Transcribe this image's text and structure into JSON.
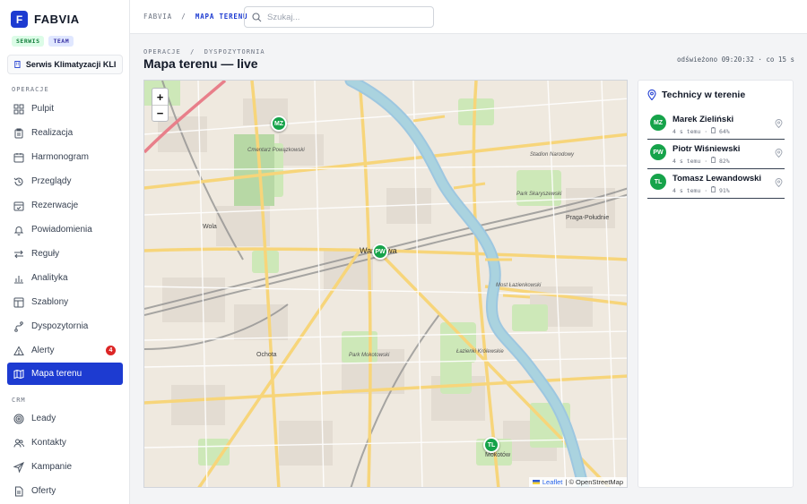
{
  "brand": {
    "name": "FABVIA",
    "logo_letter": "F"
  },
  "badges": [
    "SERWIS",
    "TEAM"
  ],
  "company": {
    "name": "Serwis Klimatyzacji KLIMA"
  },
  "sidebar": {
    "sections": [
      {
        "label": "OPERACJE",
        "items": [
          {
            "label": "Pulpit",
            "icon": "grid-icon"
          },
          {
            "label": "Realizacja",
            "icon": "clipboard-icon"
          },
          {
            "label": "Harmonogram",
            "icon": "calendar-icon"
          },
          {
            "label": "Przeglądy",
            "icon": "history-icon"
          },
          {
            "label": "Rezerwacje",
            "icon": "calendar-check-icon"
          },
          {
            "label": "Powiadomienia",
            "icon": "bell-icon"
          },
          {
            "label": "Reguły",
            "icon": "arrows-icon"
          },
          {
            "label": "Analityka",
            "icon": "chart-icon"
          },
          {
            "label": "Szablony",
            "icon": "template-icon"
          },
          {
            "label": "Dyspozytornia",
            "icon": "route-icon"
          },
          {
            "label": "Alerty",
            "icon": "alert-icon",
            "badge": "4"
          },
          {
            "label": "Mapa terenu",
            "icon": "map-icon",
            "active": true
          }
        ]
      },
      {
        "label": "CRM",
        "items": [
          {
            "label": "Leady",
            "icon": "target-icon"
          },
          {
            "label": "Kontakty",
            "icon": "users-icon"
          },
          {
            "label": "Kampanie",
            "icon": "send-icon"
          },
          {
            "label": "Oferty",
            "icon": "document-icon"
          }
        ]
      }
    ]
  },
  "topbar": {
    "breadcrumb_root": "FABVIA",
    "breadcrumb_sep": "/",
    "breadcrumb_current": "MAPA TERENU",
    "search_placeholder": "Szukaj..."
  },
  "header": {
    "kicker": "OPERACJE  /  DYSPOZYTORNIA",
    "title": "Mapa terenu — live",
    "refresh": "odświeżono 09:20:32 · co 15 s"
  },
  "map": {
    "zoom_in": "+",
    "zoom_out": "−",
    "markers": [
      "MZ",
      "PW",
      "TL"
    ],
    "city_label": "Warszawa",
    "labels": [
      "Wola",
      "Ochota",
      "Mokotów",
      "Praga-Południe",
      "Most Łazienkowski",
      "Park Skaryszewski",
      "Cmentarz Powązkowski",
      "Park Mokotowski",
      "Łazienki Królewskie",
      "Stadion Narodowy"
    ],
    "attribution_link": "Leaflet",
    "attribution_text": "| © OpenStreetMap"
  },
  "panel": {
    "title": "Technicy w terenie",
    "technicians": [
      {
        "initials": "MZ",
        "name": "Marek Zieliński",
        "seen": "4 s temu",
        "battery": "64%"
      },
      {
        "initials": "PW",
        "name": "Piotr Wiśniewski",
        "seen": "4 s temu",
        "battery": "82%"
      },
      {
        "initials": "TL",
        "name": "Tomasz Lewandowski",
        "seen": "4 s temu",
        "battery": "91%"
      }
    ]
  },
  "colors": {
    "accent": "#1d3bd1",
    "marker": "#16a34a",
    "alert": "#dc2626"
  }
}
